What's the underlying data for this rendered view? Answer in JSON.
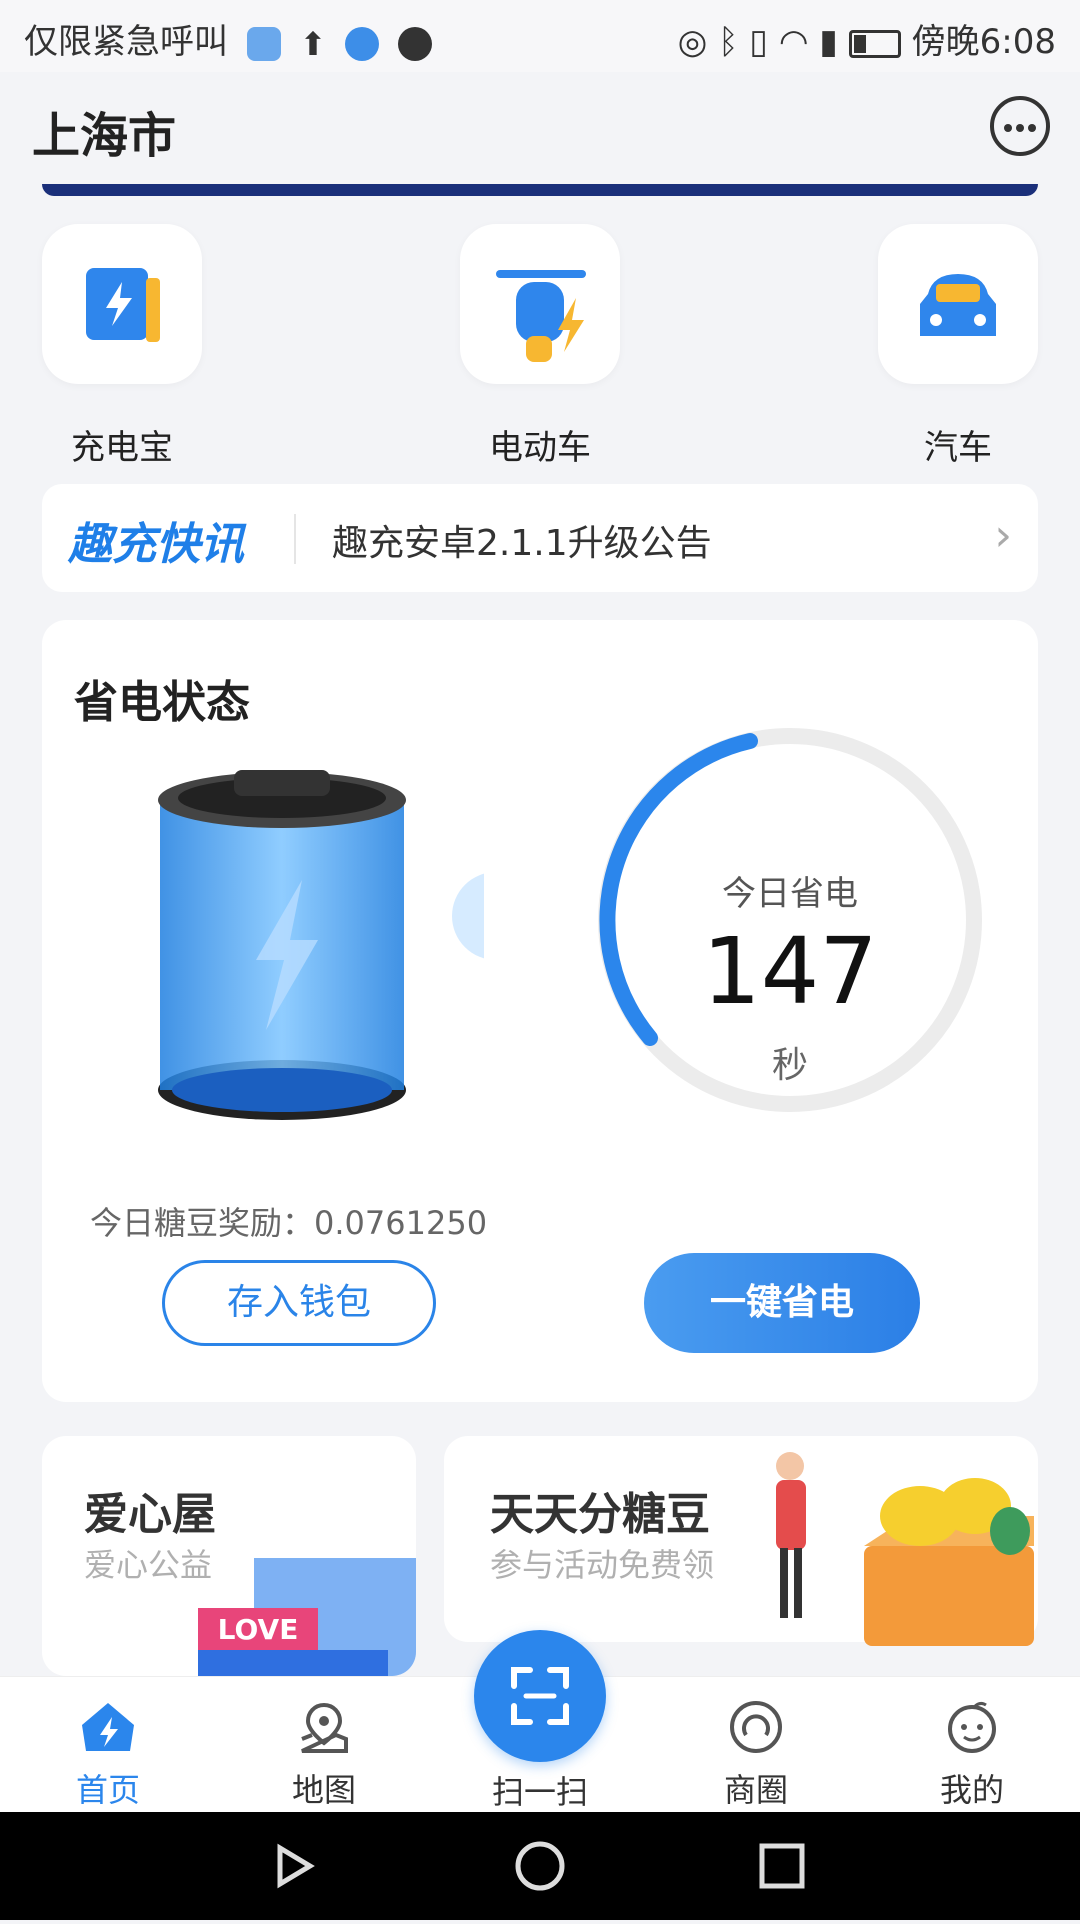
{
  "status_bar": {
    "carrier": "仅限紧急呼叫",
    "time": "傍晚6:08"
  },
  "header": {
    "city": "上海市"
  },
  "categories": [
    {
      "label": "充电宝",
      "icon": "power-bank-icon"
    },
    {
      "label": "电动车",
      "icon": "e-scooter-icon"
    },
    {
      "label": "汽车",
      "icon": "car-icon"
    }
  ],
  "news": {
    "logo": "趣充快讯",
    "text": "趣充安卓2.1.1升级公告"
  },
  "power_card": {
    "title": "省电状态",
    "ring_label": "今日省电",
    "ring_value": "147",
    "ring_unit": "秒",
    "reward": "今日糖豆奖励：0.0761250",
    "wallet_button": "存入钱包",
    "save_button": "一键省电",
    "accent_color": "#2b86ec"
  },
  "promos": [
    {
      "title": "爱心屋",
      "subtitle": "爱心公益",
      "badge": "LOVE"
    },
    {
      "title": "天天分糖豆",
      "subtitle": "参与活动免费领"
    }
  ],
  "tabs": [
    {
      "label": "首页",
      "icon": "home-icon",
      "active": true
    },
    {
      "label": "地图",
      "icon": "map-icon"
    },
    {
      "label": "扫一扫",
      "icon": "scan-icon"
    },
    {
      "label": "商圈",
      "icon": "business-circle-icon"
    },
    {
      "label": "我的",
      "icon": "profile-icon"
    }
  ]
}
